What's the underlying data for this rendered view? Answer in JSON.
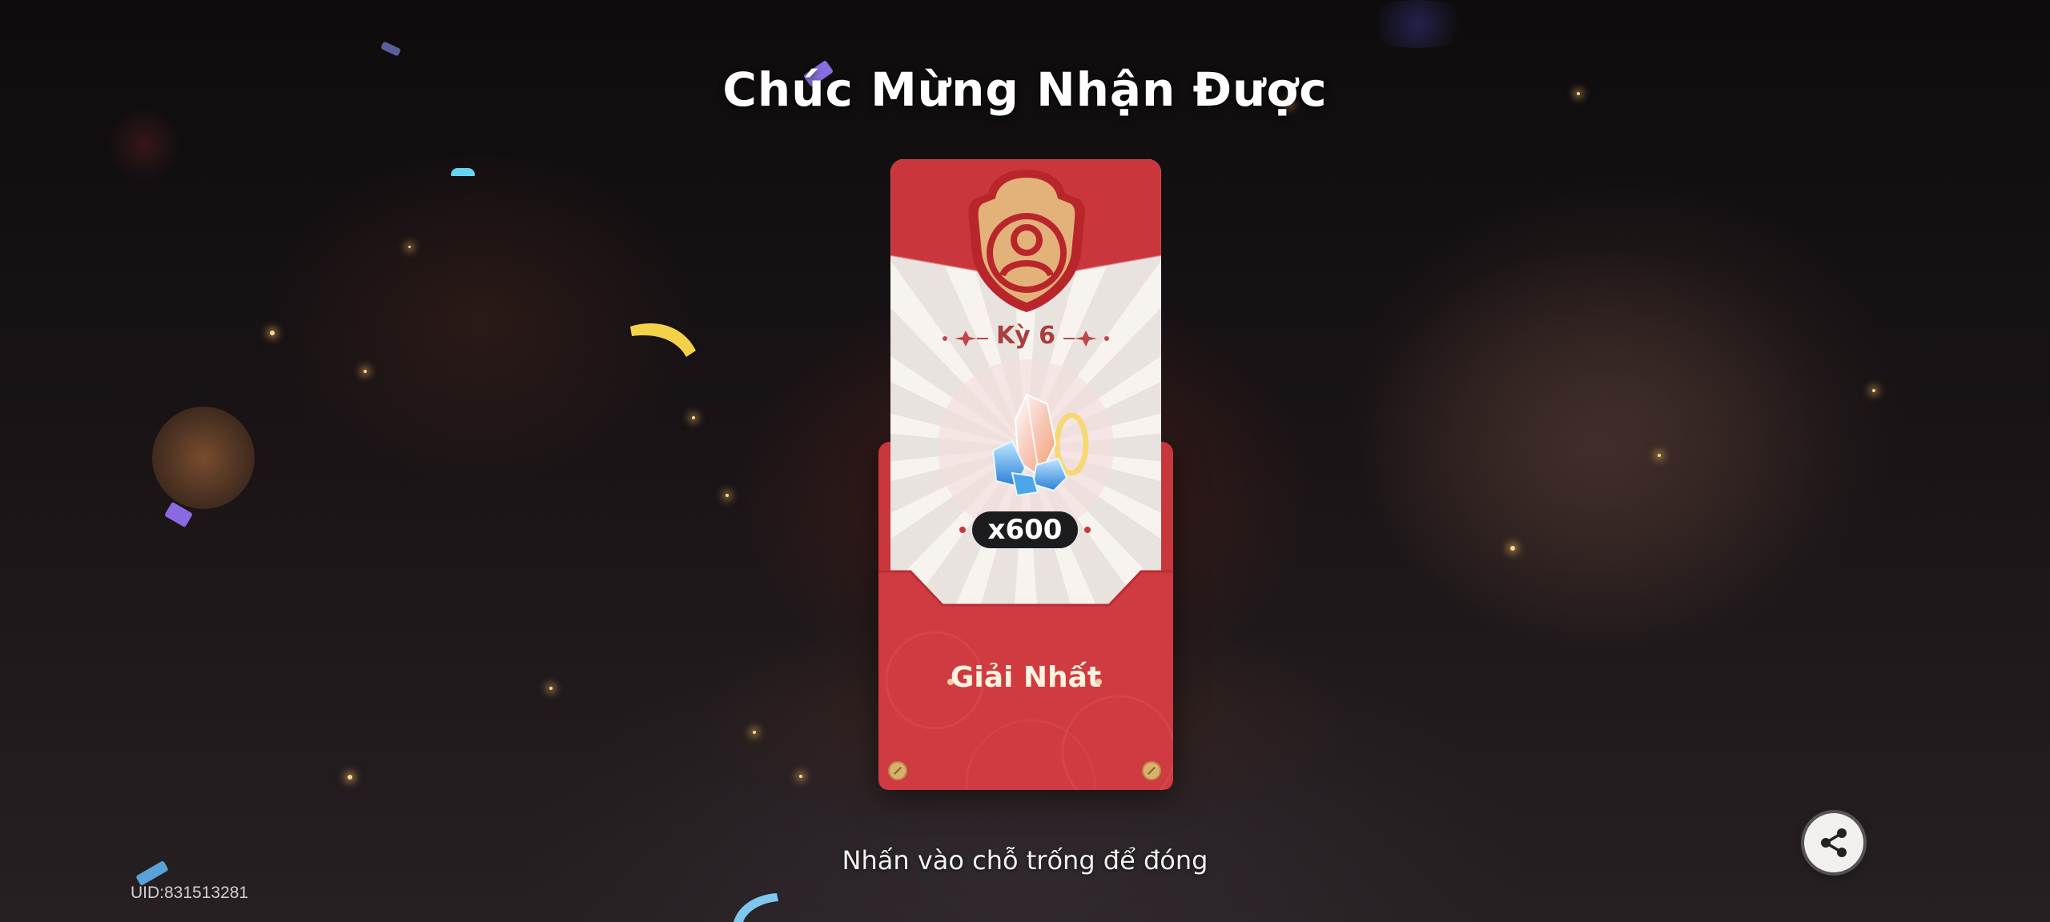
{
  "title": "Chúc Mừng Nhận Được",
  "reward": {
    "period_label": "Kỳ 6",
    "item_icon": "crystal-gem-icon",
    "quantity": "x600",
    "prize_label": "Giải Nhất"
  },
  "hint": "Nhấn vào chỗ trống để đóng",
  "uid": "UID:831513281",
  "share_icon": "share-icon",
  "colors": {
    "envelope_red": "#c9373d",
    "card_paper": "#e9e3df",
    "badge_gold": "#e3b27a",
    "pill_dark": "#1c1c1e"
  }
}
